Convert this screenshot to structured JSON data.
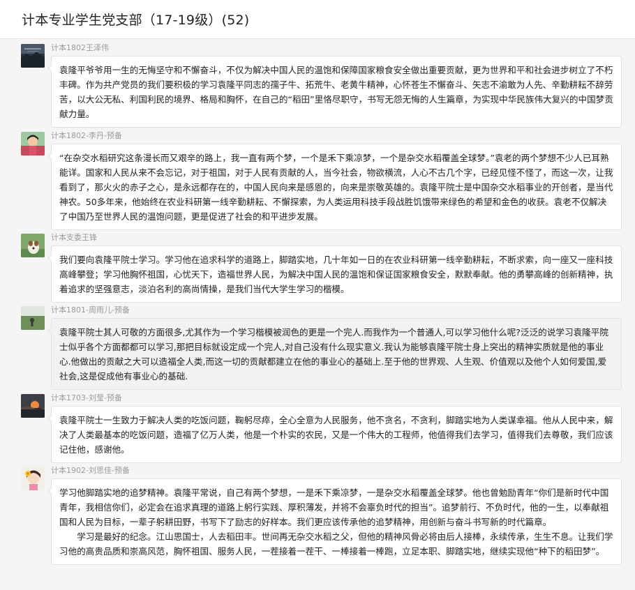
{
  "header": {
    "title": "计本专业学生党支部（17-19级）(52)"
  },
  "messages": [
    {
      "sender": "计本1802王泽伟",
      "avatar": "landscape-avatar",
      "paragraphs": [
        "袁隆平爷爷用一生的无悔坚守和不懈奋斗，不仅为解决中国人民的温饱和保障国家粮食安全做出重要贡献，更为世界和平和社会进步树立了不朽丰碑。作为共产党员的我们要积极的学习袁隆平同志的孺子牛、拓荒牛、老黄牛精神，心怀苍生不懈奋斗、矢志不渝敢为人先、辛勤耕耘不辞劳苦，以大公无私、利国利民的境界、格局和胸怀，在自己的“稻田”里恪尽职守，书写无怨无悔的人生篇章，为实现中华民族伟大复兴的中国梦贡献力量。"
      ]
    },
    {
      "sender": "计本1802-李丹-预备",
      "avatar": "girl-avatar",
      "paragraphs": [
        "“在杂交水稻研究这条漫长而又艰辛的路上，我一直有两个梦，一个是禾下乘凉梦，一个是杂交水稻覆盖全球梦。”袁老的两个梦想不少人已耳熟能详。国家和人民从来不会忘记，对于祖国，对于人民有贡献的人，当今社会，物欲横流，人心不古几个字，已经见怪不怪了，而这一次，让我看到了，那火火的赤子之心，是永远都存在的，中国人民向来是感恩的，向来是崇敬英雄的。袁隆平院士是中国杂交水稻事业的开创者，是当代神农。50多年来，他始终在农业科研第一线辛勤耕耘、不懈探索，为人类运用科技手段战胜饥饿带来绿色的希望和金色的收获。袁老不仅解决了中国乃至世界人民的温饱问题，更是促进了社会的和平进步发展。"
      ]
    },
    {
      "sender": "计本支委王锋",
      "avatar": "dog-avatar",
      "paragraphs": [
        "我们要向袁隆平院士学习。学习他在追求科学的道路上，脚踏实地，几十年如一日的在农业科研第一线辛勤耕耘，不断求索，向一座又一座科技高峰攀登；学习他胸怀祖国，心忧天下，造福世界人民，为解决中国人民的温饱和保证国家粮食安全，默默奉献。他的勇攀高峰的创新精神，执着追求的坚强意志，淡泊名利的高尚情操，是我们当代大学生学习的楷模。"
      ]
    },
    {
      "sender": "计本1801-周雨儿-预备",
      "avatar": "field-avatar",
      "paragraphs": [
        "袁隆平院士其人可敬的方面很多,尤其作为一个学习楷模被润色的更是一个完人.而我作为一个普通人,可以学习他什么呢?泛泛的说学习袁隆平院士似乎各个方面都都可以学习,那把目标就设定成一个完人,对自己没有什么现实意义.我认为能够袁隆平院士身上突出的精神实质就是他的事业心.他做出的贡献之大可以造福全人类,而这一切的贡献都建立在他的事业心的基础上.至于他的世界观、人生观、价值观以及他个人如何爱国,爱社会,这是促成他有事业心的基础."
      ]
    },
    {
      "sender": "计本1703-刘莹-预备",
      "avatar": "sunset-avatar",
      "paragraphs": [
        "袁隆平院士一生致力于解决人类的吃饭问题，鞠躬尽瘁，全心全意为人民服务，他不贪名，不贪利，脚踏实地为人类谋幸福。他从人民中来，解决了人类最基本的吃饭问题，造福了亿万人类，他是一个朴实的农民，又是一个伟大的工程师，他值得我们去学习，值得我们去尊敬，我们应该记住他，感谢他。"
      ]
    },
    {
      "sender": "计本1902-刘思佳-预备",
      "avatar": "flower-girl-avatar",
      "paragraphs": [
        "学习他脚踏实地的追梦精神。袁隆平常说，自己有两个梦想，一是禾下乘凉梦，一是杂交水稻覆盖全球梦。他也曾勉励青年“你们是新时代中国青年，我相信你们，必定会在追求真理的道路上躬行实践、厚积薄发，并将不会辜负时代的担当”。追梦前行、不负时代，他的一生，以奉献祖国和人民为目标，一辈子躬耕田野，书写下了励志的好样本。我们更应该传承他的追梦精神，用创新与奋斗书写新的时代篇章。",
        "学习是最好的纪念。江山思国士，人去稻田丰。世间再无杂交水稻之父，但他的精神风骨必将由后人接棒，永续传承，生生不息。让我们学习他的高贵品质和崇高风范，胸怀祖国、服务人民，一茬接着一茬干、一棒接着一棒跑，立足本职、脚踏实地，继续实现他“种下的稻田梦”。"
      ]
    }
  ]
}
